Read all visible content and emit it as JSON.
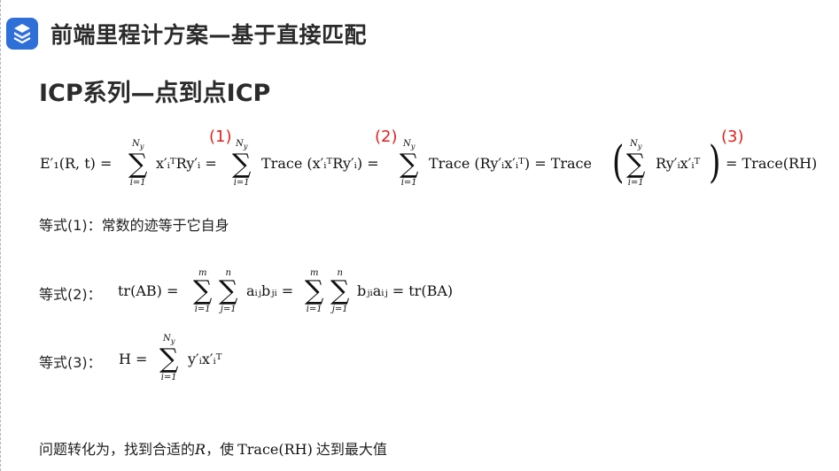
{
  "header": {
    "title": "前端里程计方案—基于直接匹配"
  },
  "section": {
    "title": "ICP系列—点到点ICP"
  },
  "equation_main": {
    "marker1": "(1)",
    "marker2": "(2)",
    "marker3": "(3)",
    "lhs": "E′₁(R, t) =",
    "sum_top": "N",
    "sum_top_sub": "y",
    "sum_bottom": "i=1",
    "term1": "x′ᵢᵀRy′ᵢ =",
    "term2": "Trace (x′ᵢᵀRy′ᵢ) =",
    "term3": "Trace (Ry′ᵢx′ᵢᵀ) = Trace",
    "term4": "Ry′ᵢx′ᵢᵀ",
    "term5": "= Trace(RH)"
  },
  "notes": {
    "eq1_label": "等式(1)：常数的迹等于它自身",
    "eq2_label": "等式(2)：",
    "eq2_math": {
      "lhs": "tr(AB) =",
      "top_m": "m",
      "top_n": "n",
      "bottom_i": "i=1",
      "bottom_j": "j=1",
      "mid": "aᵢⱼbⱼᵢ =",
      "end": "bⱼᵢaᵢⱼ = tr(BA)"
    },
    "eq3_label": "等式(3)：",
    "eq3_math": {
      "lhs": "H =",
      "top": "N",
      "top_sub": "y",
      "bottom": "i=1",
      "term": "y′ᵢx′ᵢᵀ"
    },
    "conclusion_part1": "问题转化为，找到合适的",
    "conclusion_R": "R",
    "conclusion_part2": "，使",
    "conclusion_math": "Trace(RH)",
    "conclusion_part3": "达到最大值"
  }
}
